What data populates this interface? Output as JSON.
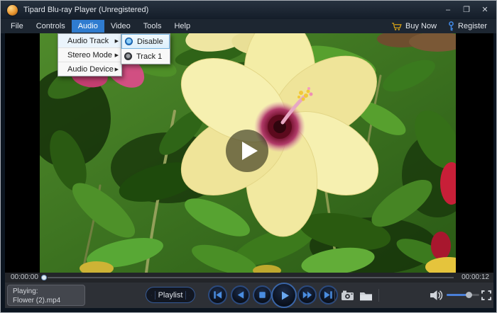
{
  "window": {
    "title": "Tipard Blu-ray Player (Unregistered)",
    "controls": {
      "minimize": "–",
      "maximize": "❐",
      "close": "✕"
    }
  },
  "menubar": {
    "items": [
      "File",
      "Controls",
      "Audio",
      "Video",
      "Tools",
      "Help"
    ],
    "active_item": "Audio",
    "buy_now": "Buy Now",
    "register": "Register"
  },
  "audio_menu": {
    "items": [
      "Audio Track",
      "Stereo Mode",
      "Audio Device"
    ],
    "arrow": "▶"
  },
  "track_submenu": {
    "items": [
      "Disable",
      "Track 1"
    ],
    "selected": "Disable"
  },
  "seekbar": {
    "elapsed": "00:00:00",
    "total": "00:00:12"
  },
  "now_playing": {
    "label": "Playing:",
    "filename": "Flower (2).mp4"
  },
  "transport": {
    "playlist": "Playlist"
  },
  "colors": {
    "menu_highlight": "#2f7cd0",
    "transport_icon": "#4a8de0",
    "play_icon": "#6aa8f0",
    "volume_fill": "#4a7fd8",
    "buy_now_icon": "#d4a017",
    "register_icon": "#3f86e0"
  }
}
